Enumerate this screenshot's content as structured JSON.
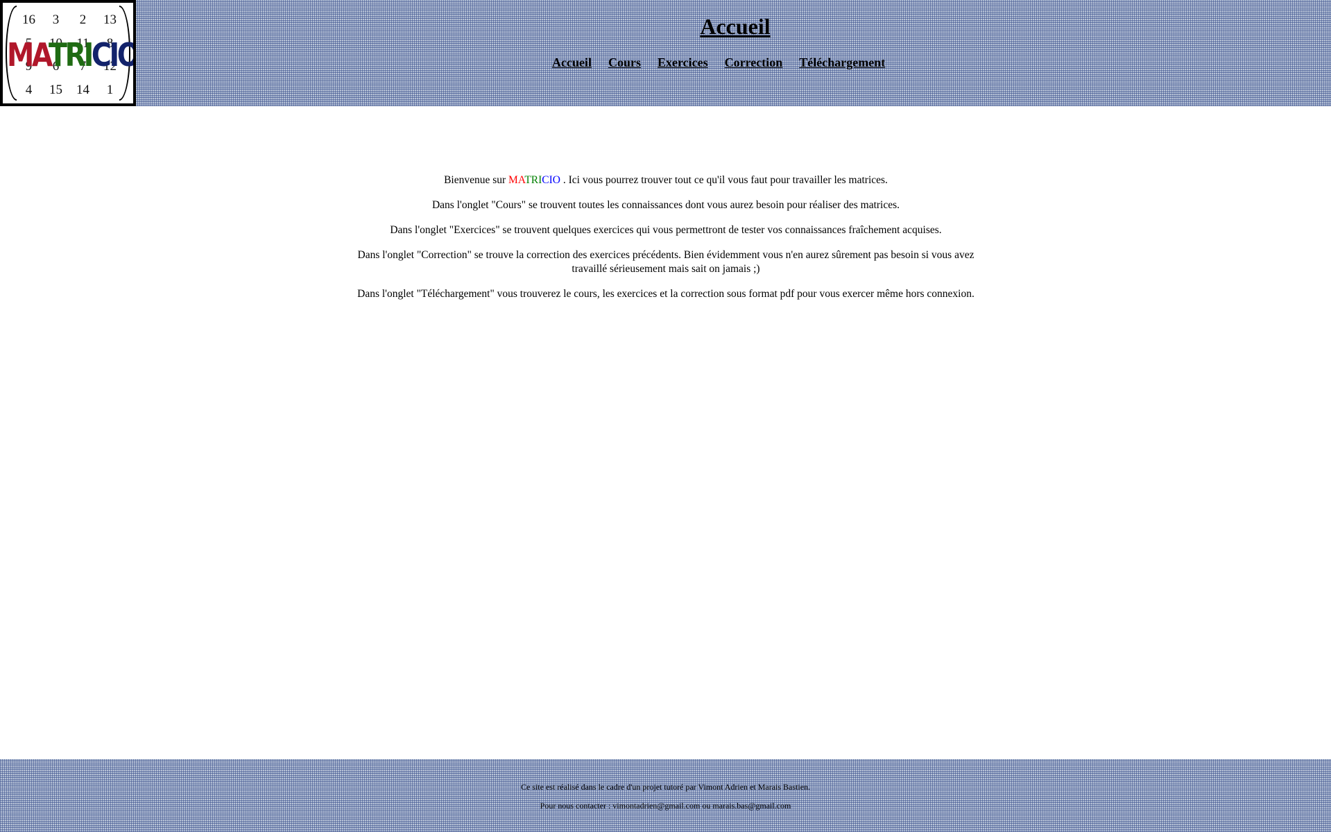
{
  "logo": {
    "matrix": [
      [
        "16",
        "3",
        "2",
        "13"
      ],
      [
        "5",
        "10",
        "11",
        "8"
      ],
      [
        "9",
        "6",
        "7",
        "12"
      ],
      [
        "4",
        "15",
        "14",
        "1"
      ]
    ],
    "word": [
      {
        "text": "MA",
        "color": "#b0172a"
      },
      {
        "text": "TRI",
        "color": "#1f6b13"
      },
      {
        "text": "CIO",
        "color": "#13236b"
      }
    ]
  },
  "header": {
    "title": "Accueil",
    "nav": [
      "Accueil",
      "Cours",
      "Exercices",
      "Correction",
      "Téléchargement"
    ]
  },
  "content": {
    "intro_prefix": "Bienvenue sur ",
    "brand": [
      {
        "text": "MA",
        "color": "#ff0000"
      },
      {
        "text": "TRI",
        "color": "#008000"
      },
      {
        "text": "CIO",
        "color": "#0000ff"
      }
    ],
    "intro_suffix": " . Ici vous pourrez trouver tout ce qu'il vous faut pour travailler les matrices.",
    "paragraphs": [
      "Dans l'onglet \"Cours\" se trouvent toutes les connaissances dont vous aurez besoin pour réaliser des matrices.",
      "Dans l'onglet \"Exercices\" se trouvent quelques exercices qui vous permettront de tester vos connaissances fraîchement acquises.",
      "Dans l'onglet \"Correction\" se trouve la correction des exercices précédents. Bien évidemment vous n'en aurez sûrement pas besoin si vous avez travaillé sérieusement mais sait on jamais ;)",
      "Dans l'onglet \"Téléchargement\" vous trouverez le cours, les exercices et la correction sous format pdf pour vous exercer même hors connexion."
    ]
  },
  "footer": {
    "credit": "Ce site est réalisé dans le cadre d'un projet tutoré par Vimont Adrien et Marais Bastien.",
    "contact": "Pour nous contacter : vimontadrien@gmail.com ou marais.bas@gmail.com"
  }
}
